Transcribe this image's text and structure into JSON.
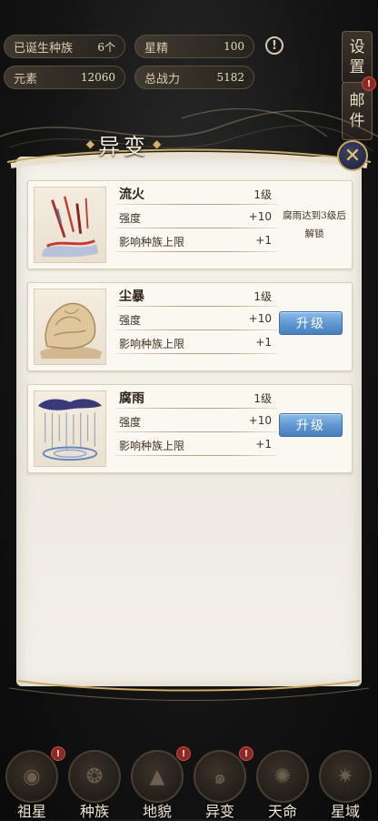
{
  "stats": {
    "races": {
      "label": "已诞生种族",
      "value": "6个"
    },
    "star_essence": {
      "label": "星精",
      "value": "100"
    },
    "element": {
      "label": "元素",
      "value": "12060"
    },
    "total_power": {
      "label": "总战力",
      "value": "5182"
    }
  },
  "side": {
    "settings": [
      "设",
      "置"
    ],
    "mail": [
      "邮",
      "件"
    ],
    "mail_badge": "!"
  },
  "alert_icon": "!",
  "panel": {
    "title": "异变",
    "close_icon": "✕"
  },
  "mutations": [
    {
      "name": "流火",
      "level": "1级",
      "stat1_label": "强度",
      "stat1_value": "+10",
      "stat2_label": "影响种族上限",
      "stat2_value": "+1",
      "locked": true,
      "lock_text": "腐雨达到3级后解锁"
    },
    {
      "name": "尘暴",
      "level": "1级",
      "stat1_label": "强度",
      "stat1_value": "+10",
      "stat2_label": "影响种族上限",
      "stat2_value": "+1",
      "locked": false,
      "button": "升级"
    },
    {
      "name": "腐雨",
      "level": "1级",
      "stat1_label": "强度",
      "stat1_value": "+10",
      "stat2_label": "影响种族上限",
      "stat2_value": "+1",
      "locked": false,
      "button": "升级"
    }
  ],
  "nav": [
    {
      "label": "祖星",
      "badge": "!"
    },
    {
      "label": "种族",
      "badge": ""
    },
    {
      "label": "地貌",
      "badge": "!"
    },
    {
      "label": "异变",
      "badge": "!"
    },
    {
      "label": "天命",
      "badge": ""
    },
    {
      "label": "星域",
      "badge": ""
    }
  ],
  "colors": {
    "upgrade_button": "#5a92cf",
    "badge": "#8a2a24",
    "gold": "#c9aa62"
  }
}
